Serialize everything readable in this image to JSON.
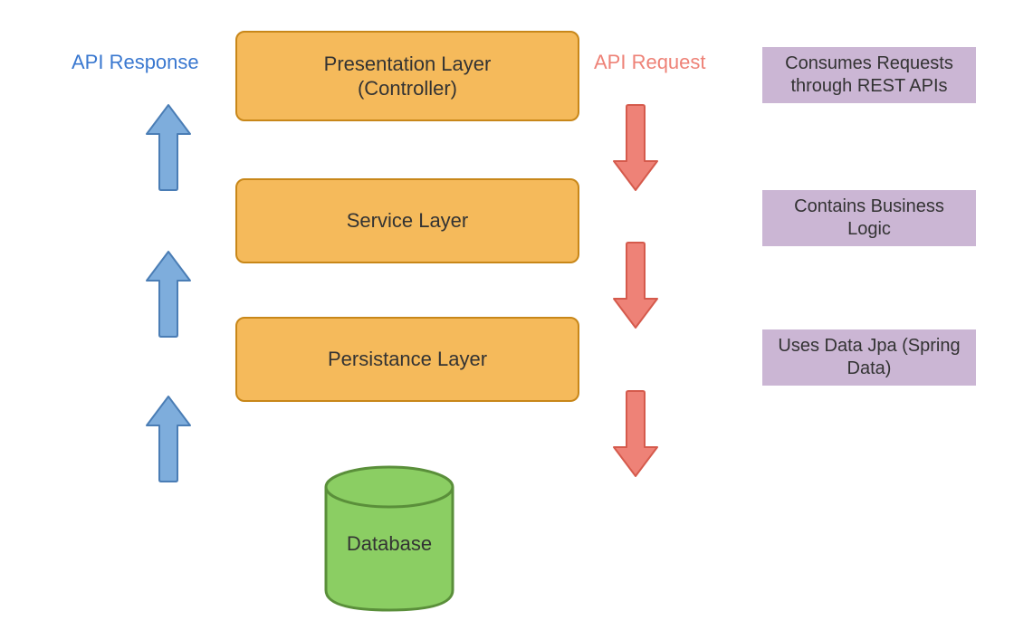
{
  "labels": {
    "response": "API Response",
    "request": "API Request"
  },
  "layers": {
    "presentation": "Presentation Layer\n(Controller)",
    "service": "Service Layer",
    "persistence": "Persistance Layer"
  },
  "descriptions": {
    "presentation": "Consumes Requests through REST APIs",
    "service": "Contains Business Logic",
    "persistence": "Uses Data Jpa (Spring Data)"
  },
  "database": {
    "label": "Database"
  },
  "colors": {
    "layer_fill": "#f5ba5b",
    "layer_stroke": "#c88719",
    "desc_fill": "#cbb6d4",
    "arrow_up_fill": "#7eaddc",
    "arrow_up_stroke": "#4a7db5",
    "arrow_down_fill": "#ee8277",
    "arrow_down_stroke": "#d55a4c",
    "db_fill": "#8bce63",
    "db_stroke": "#5a8f3a",
    "response_text": "#3a78d0",
    "request_text": "#ee8277"
  }
}
